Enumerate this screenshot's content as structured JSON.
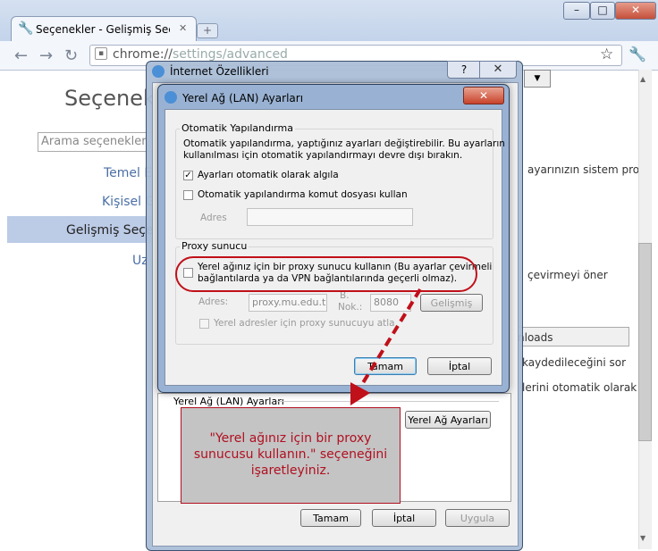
{
  "browser": {
    "tab_title": "Seçenekler - Gelişmiş Seçen",
    "tab_close": "✕",
    "url_scheme": "chrome://",
    "url_path": "settings/advanced"
  },
  "settings": {
    "title": "Seçenekler",
    "search_placeholder": "Arama seçenekler",
    "sidebar": [
      "Temel E",
      "Kişisel G",
      "Gelişmiş Seçen",
      "Uz"
    ],
    "right_texts": {
      "system_proxy": "ayarınızın sistem pro",
      "translate": "çevirmeyi öner",
      "downloads_btn": "nloads",
      "ask_save": "kaydedileceğini sor",
      "auto_open": "lerini otomatik olarak a"
    }
  },
  "internet_options": {
    "title": "İnternet Özellikleri",
    "help": "?",
    "lan_group_title": "Yerel Ağ (LAN) Ayarları",
    "lan_settings_button": "Yerel Ağ Ayarları",
    "ok": "Tamam",
    "cancel": "İptal",
    "apply": "Uygula"
  },
  "lan_dialog": {
    "title": "Yerel Ağ (LAN) Ayarları",
    "auto_group": "Otomatik Yapılandırma",
    "auto_desc_1": "Otomatik yapılandırma, yaptığınız ayarları değiştirebilir. Bu ayarların",
    "auto_desc_2": "kullanılması için otomatik yapılandırmayı devre dışı bırakın.",
    "auto_detect_label": "Ayarları otomatik olarak algıla",
    "auto_detect_checked": true,
    "script_label": "Otomatik yapılandırma komut dosyası kullan",
    "address_label": "Adres",
    "proxy_group": "Proxy sunucu",
    "proxy_use_label_1": "Yerel ağınız için bir proxy sunucu kullanın (Bu ayarlar çevirmeli",
    "proxy_use_label_2": "bağlantılarda ya da VPN bağlantılarında geçerli olmaz).",
    "proxy_address_label": "Adres:",
    "proxy_address_value": "proxy.mu.edu.tr",
    "port_label_1": "B.",
    "port_label_2": "Nok.:",
    "port_value": "8080",
    "advanced_button": "Gelişmiş",
    "bypass_label": "Yerel adresler için proxy sunucuyu atla",
    "ok": "Tamam",
    "cancel": "İptal"
  },
  "annotation": {
    "callout_text": "\"Yerel ağınız için bir proxy sunucusu kullanın.\" seçeneğini işaretleyiniz.",
    "color": "#c0101a"
  }
}
